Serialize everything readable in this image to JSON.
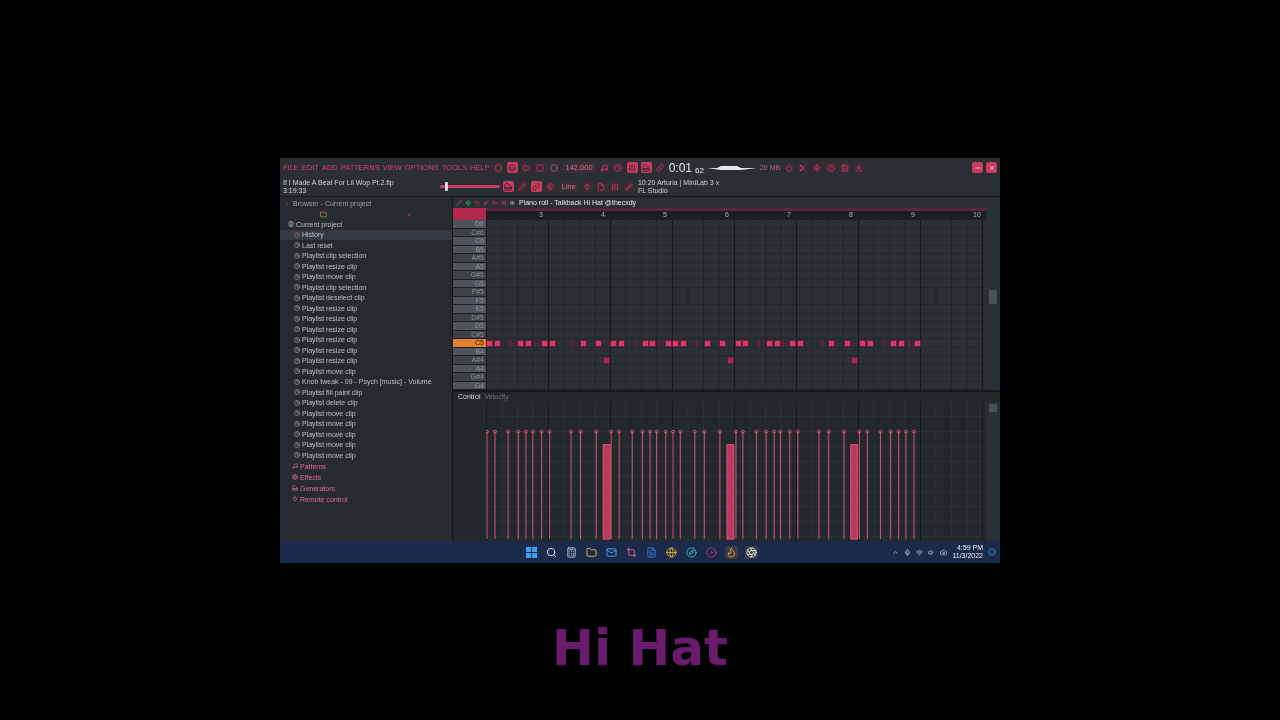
{
  "menu": [
    "FILE",
    "EDIT",
    "ADD",
    "PATTERNS",
    "VIEW",
    "OPTIONS",
    "TOOLS",
    "HELP"
  ],
  "project": {
    "title": "If I Made A Beat For Lil Wop Pt.2.flp",
    "time": "3:19:33"
  },
  "transport": {
    "volume": {
      "level": 0.08
    },
    "tempo": "142.000",
    "time_main": "0:01",
    "time_cs": "62",
    "memory": "20 MB",
    "snap": "Line"
  },
  "hint": {
    "line1": "10:20  Arturia | MiniLab 3 x",
    "line2": "FL Studio"
  },
  "browser": {
    "title": "Browser - Current project",
    "root": "Current project",
    "history": {
      "label": "History",
      "selected": true,
      "items": [
        "Last reset",
        "Playlist clip selection",
        "Playlist resize clip",
        "Playlist move clip",
        "Playlist clip selection",
        "Playlist deselect clip",
        "Playlist resize clip",
        "Playlist resize clip",
        "Playlist resize clip",
        "Playlist resize clip",
        "Playlist resize clip",
        "Playlist resize clip",
        "Playlist move clip",
        "Knob tweak - 09 - Psych [music] - Volume",
        "Playlist fill paint clip",
        "Playlist delete clip",
        "Playlist move clip",
        "Playlist move clip",
        "Playlist move clip",
        "Playlist move clip",
        "Playlist move clip"
      ]
    },
    "folders": [
      {
        "label": "Patterns",
        "selected": false
      },
      {
        "label": "Effects",
        "selected": false
      },
      {
        "label": "Generators",
        "selected": false
      },
      {
        "label": "Remote control",
        "selected": false
      }
    ]
  },
  "piano_roll": {
    "title": "Piano roll - Talkback Hi Hat @thecxdy",
    "ruler": [
      "3",
      "4",
      "5",
      "6",
      "7",
      "8",
      "9",
      "10"
    ],
    "keys": [
      {
        "label": "D6",
        "selected": false
      },
      {
        "label": "C#6",
        "selected": false
      },
      {
        "label": "C6",
        "selected": false
      },
      {
        "label": "B5",
        "selected": false
      },
      {
        "label": "A#5",
        "selected": false
      },
      {
        "label": "A5",
        "selected": false
      },
      {
        "label": "G#5",
        "selected": false
      },
      {
        "label": "G5",
        "selected": false
      },
      {
        "label": "F#5",
        "selected": false
      },
      {
        "label": "F5",
        "selected": false
      },
      {
        "label": "E5",
        "selected": false
      },
      {
        "label": "D#5",
        "selected": false
      },
      {
        "label": "D5",
        "selected": false
      },
      {
        "label": "C#5",
        "selected": false
      },
      {
        "label": "C5",
        "selected": true
      },
      {
        "label": "B4",
        "selected": false
      },
      {
        "label": "A#4",
        "selected": false
      },
      {
        "label": "A4",
        "selected": false
      },
      {
        "label": "G#4",
        "selected": false
      },
      {
        "label": "G4",
        "selected": false
      }
    ],
    "notes": [
      {
        "kind": "labeled"
      },
      {
        "kind": "labeled"
      },
      {
        "kind": "short"
      },
      {
        "kind": "labeled"
      },
      {
        "kind": "labeled"
      },
      {
        "kind": "short"
      },
      {
        "kind": "labeled"
      },
      {
        "kind": "labeled"
      },
      {
        "kind": "short"
      },
      {
        "kind": "labeled"
      },
      {
        "kind": "labeled"
      },
      {
        "kind": "labeled"
      },
      {
        "kind": "labeled"
      },
      {
        "kind": "short"
      },
      {
        "kind": "labeled"
      },
      {
        "kind": "labeled"
      },
      {
        "kind": "short"
      },
      {
        "kind": "labeled"
      },
      {
        "kind": "labeled"
      },
      {
        "kind": "labeled"
      },
      {
        "kind": "short"
      },
      {
        "kind": "labeled"
      },
      {
        "kind": "labeled"
      },
      {
        "kind": "labeled"
      },
      {
        "kind": "labeled"
      },
      {
        "kind": "short"
      },
      {
        "kind": "labeled"
      },
      {
        "kind": "labeled"
      },
      {
        "kind": "short"
      },
      {
        "kind": "labeled"
      },
      {
        "kind": "labeled"
      },
      {
        "kind": "short"
      },
      {
        "kind": "labeled"
      },
      {
        "kind": "labeled"
      },
      {
        "kind": "labeled"
      },
      {
        "kind": "labeled"
      },
      {
        "kind": "short"
      },
      {
        "kind": "labeled"
      },
      {
        "kind": "labeled"
      },
      {
        "kind": "short"
      },
      {
        "kind": "labeled"
      }
    ],
    "control": {
      "label": "Control",
      "parameter": "Velocity"
    }
  },
  "taskbar": {
    "time": "4:59 PM",
    "date": "11/3/2022"
  },
  "caption": "Hi Hat"
}
